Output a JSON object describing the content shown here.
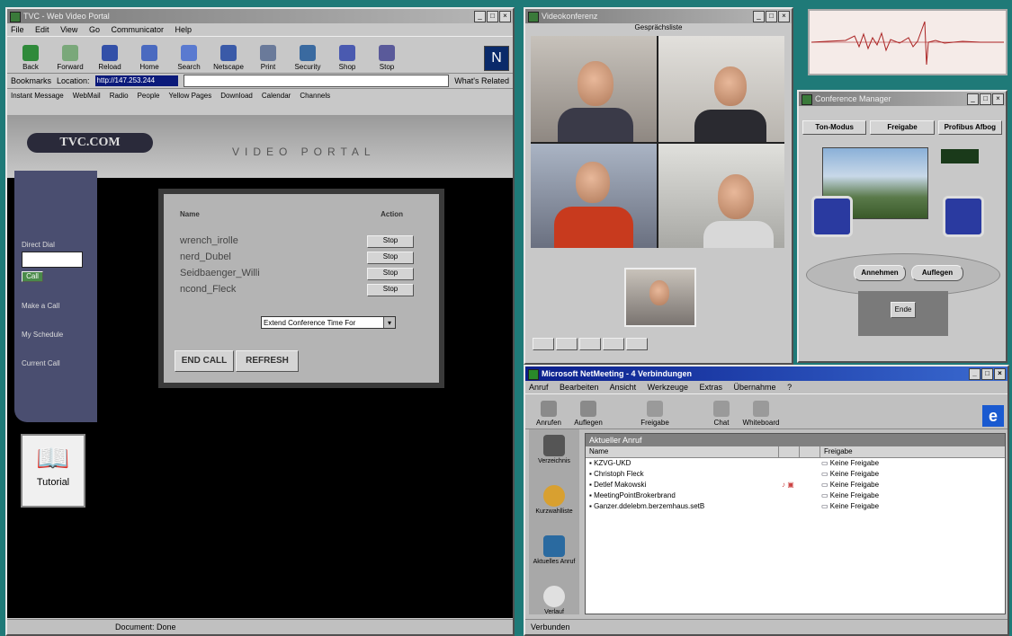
{
  "browser": {
    "title": "TVC - Web Video Portal",
    "menu": [
      "File",
      "Edit",
      "View",
      "Go",
      "Communicator",
      "Help"
    ],
    "toolbar": [
      "Back",
      "Forward",
      "Reload",
      "Home",
      "Search",
      "Netscape",
      "Print",
      "Security",
      "Shop",
      "Stop"
    ],
    "bookmarks_label": "Bookmarks",
    "location_label": "Location:",
    "location_value": "http://147.253.244",
    "whats_related": "What's Related",
    "links": [
      "Instant Message",
      "WebMail",
      "Radio",
      "People",
      "Yellow Pages",
      "Download",
      "Calendar",
      "Channels"
    ],
    "status": "Document: Done"
  },
  "portal": {
    "logo": "TVC.COM",
    "banner": "VIDEO PORTAL",
    "sidebar": {
      "direct_dial_label": "Direct Dial",
      "dial_button": "Call",
      "items": [
        "Make a Call",
        "My Schedule",
        "Current Call"
      ]
    },
    "tutorial_label": "Tutorial",
    "participants_header": {
      "name": "Name",
      "action": "Action"
    },
    "participants": [
      "wrench_irolle",
      "nerd_Dubel",
      "Seidbaenger_Willi",
      "ncond_Fleck"
    ],
    "stop_label": "Stop",
    "extend_select": "Extend Conference Time For",
    "end_call": "END CALL",
    "refresh": "REFRESH"
  },
  "conference": {
    "title": "Videokonferenz",
    "tab": "Gesprächsliste"
  },
  "conf_manager": {
    "title": "Conference Manager",
    "buttons": [
      "Ton-Modus",
      "Freigabe",
      "Profibus Afbog"
    ],
    "oval_buttons": [
      "Annehmen",
      "Auflegen"
    ],
    "end_label": "Ende"
  },
  "netmeeting": {
    "title": "Microsoft NetMeeting - 4 Verbindungen",
    "menu": [
      "Anruf",
      "Bearbeiten",
      "Ansicht",
      "Werkzeuge",
      "Extras",
      "Übernahme",
      "?"
    ],
    "toolbar": [
      "Anrufen",
      "Auflegen",
      "Freigabe",
      "Chat",
      "Whiteboard"
    ],
    "sidebar": [
      "Verzeichnis",
      "Kurzwahlliste",
      "Aktuelles Anruf",
      "Verlauf"
    ],
    "list_header": "Aktueller Anruf",
    "columns": [
      "Name",
      "Freigabe"
    ],
    "rows": [
      {
        "name": "KZVG-UKD",
        "share": "Keine Freigabe"
      },
      {
        "name": "Christoph Fleck",
        "share": "Keine Freigabe"
      },
      {
        "name": "Detlef Makowski",
        "share": "Keine Freigabe"
      },
      {
        "name": "MeetingPointBrokerbrand",
        "share": "Keine Freigabe"
      },
      {
        "name": "Ganzer.ddelebm.berzemhaus.setB",
        "share": "Keine Freigabe"
      }
    ],
    "status": "Verbunden"
  }
}
